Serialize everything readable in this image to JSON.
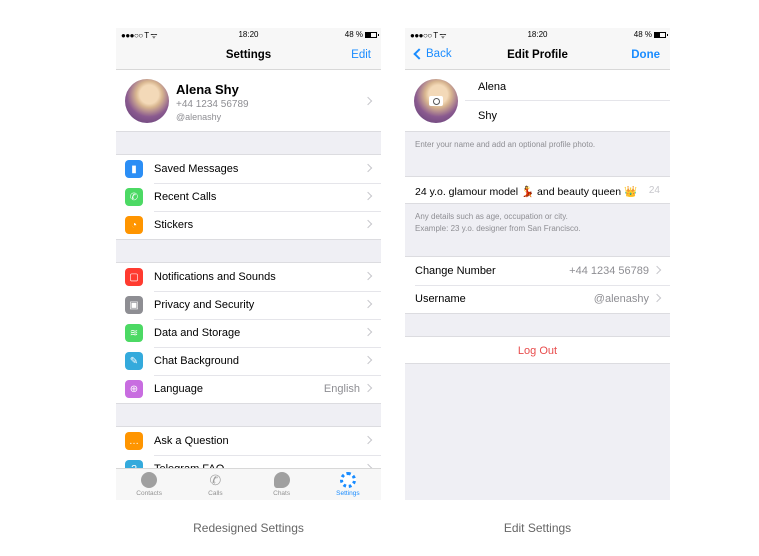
{
  "status_bar": {
    "signal": "●●●○○ T ᯤ",
    "time": "18:20",
    "battery": "48 %"
  },
  "left_screen": {
    "nav": {
      "title": "Settings",
      "edit_label": "Edit"
    },
    "profile": {
      "name": "Alena Shy",
      "phone": "+44 1234 56789",
      "username": "@alenashy"
    },
    "groups": [
      {
        "items": [
          {
            "label": "Saved Messages",
            "icon": "bookmark-icon",
            "color": "#2b8ef5",
            "glyph": "▮"
          },
          {
            "label": "Recent Calls",
            "icon": "phone-icon",
            "color": "#4cd964",
            "glyph": "✆"
          },
          {
            "label": "Stickers",
            "icon": "sticker-icon",
            "color": "#ff9500",
            "glyph": "◔"
          }
        ]
      },
      {
        "items": [
          {
            "label": "Notifications and Sounds",
            "icon": "notification-icon",
            "color": "#ff3b30",
            "glyph": "▢"
          },
          {
            "label": "Privacy and Security",
            "icon": "lock-icon",
            "color": "#8e8e93",
            "glyph": "🔒"
          },
          {
            "label": "Data and Storage",
            "icon": "database-icon",
            "color": "#4cd964",
            "glyph": "≋"
          },
          {
            "label": "Chat Background",
            "icon": "brush-icon",
            "color": "#34aadc",
            "glyph": "✎"
          },
          {
            "label": "Language",
            "icon": "globe-icon",
            "color": "#c86de0",
            "glyph": "⊕",
            "value": "English"
          }
        ]
      },
      {
        "items": [
          {
            "label": "Ask a Question",
            "icon": "chat-bubble-icon",
            "color": "#ff9500",
            "glyph": "…"
          },
          {
            "label": "Telegram FAQ",
            "icon": "help-icon",
            "color": "#34aadc",
            "glyph": "?"
          }
        ]
      }
    ],
    "tabs": [
      {
        "label": "Contacts",
        "icon": "contacts-icon",
        "active": false
      },
      {
        "label": "Calls",
        "icon": "calls-icon",
        "active": false
      },
      {
        "label": "Chats",
        "icon": "chats-icon",
        "active": false
      },
      {
        "label": "Settings",
        "icon": "settings-icon",
        "active": true
      }
    ],
    "caption": "Redesigned Settings"
  },
  "right_screen": {
    "nav": {
      "back_label": "Back",
      "title": "Edit Profile",
      "done_label": "Done"
    },
    "first_name": "Alena",
    "last_name": "Shy",
    "name_note": "Enter your name and add an optional profile photo.",
    "bio": "24 y.o. glamour model 💃 and beauty queen 👑",
    "bio_counter": "24",
    "bio_note_line1": "Any details such as age, occupation or city.",
    "bio_note_line2": "Example: 23 y.o. designer from San Francisco.",
    "rows": [
      {
        "label": "Change Number",
        "value": "+44 1234 56789"
      },
      {
        "label": "Username",
        "value": "@alenashy"
      }
    ],
    "logout_label": "Log Out",
    "caption": "Edit Settings"
  }
}
